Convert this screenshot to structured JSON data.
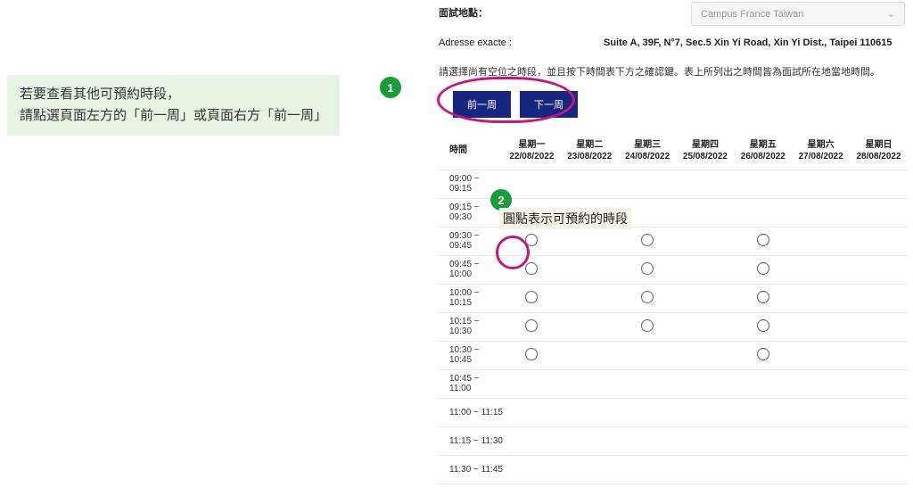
{
  "hint": {
    "line1": "若要查看其他可預約時段，",
    "line2": "請點選頁面左方的「前一周」或頁面右方「前一周」"
  },
  "location_label": "面試地點：",
  "location_value": "Campus France Taiwan",
  "address_label": "Adresse exacte :",
  "address_value": "Suite A, 39F, N°7, Sec.5 Xin Yi Road, Xin Yi Dist., Taipei 110615",
  "instruction": "請選擇尚有空位之時段，並且按下時間表下方之確認鍵。表上所列出之時間皆為面試所在地當地時間。",
  "buttons": {
    "prev": "前一周",
    "next": "下一周"
  },
  "badges": {
    "one": "1",
    "two": "2"
  },
  "radio_note": "圓點表示可預約的時段",
  "headers": {
    "time": "時間",
    "days": [
      {
        "dow": "星期一",
        "date": "22/08/2022"
      },
      {
        "dow": "星期二",
        "date": "23/08/2022"
      },
      {
        "dow": "星期三",
        "date": "24/08/2022"
      },
      {
        "dow": "星期四",
        "date": "25/08/2022"
      },
      {
        "dow": "星期五",
        "date": "26/08/2022"
      },
      {
        "dow": "星期六",
        "date": "27/08/2022"
      },
      {
        "dow": "星期日",
        "date": "28/08/2022"
      }
    ]
  },
  "slots": [
    {
      "time": "09:00 ~ 09:15",
      "avail": [
        false,
        false,
        false,
        false,
        false,
        false,
        false
      ]
    },
    {
      "time": "09:15 ~ 09:30",
      "avail": [
        false,
        false,
        false,
        false,
        false,
        false,
        false
      ]
    },
    {
      "time": "09:30 ~ 09:45",
      "avail": [
        true,
        false,
        true,
        false,
        true,
        false,
        false
      ]
    },
    {
      "time": "09:45 ~ 10:00",
      "avail": [
        true,
        false,
        true,
        false,
        true,
        false,
        false
      ]
    },
    {
      "time": "10:00 ~ 10:15",
      "avail": [
        true,
        false,
        true,
        false,
        true,
        false,
        false
      ]
    },
    {
      "time": "10:15 ~ 10:30",
      "avail": [
        true,
        false,
        true,
        false,
        true,
        false,
        false
      ]
    },
    {
      "time": "10:30 ~ 10:45",
      "avail": [
        true,
        false,
        false,
        false,
        true,
        false,
        false
      ]
    },
    {
      "time": "10:45 ~ 11:00",
      "avail": [
        false,
        false,
        false,
        false,
        false,
        false,
        false
      ]
    },
    {
      "time": "11:00 ~ 11:15",
      "avail": [
        false,
        false,
        false,
        false,
        false,
        false,
        false
      ]
    },
    {
      "time": "11:15 ~ 11:30",
      "avail": [
        false,
        false,
        false,
        false,
        false,
        false,
        false
      ]
    },
    {
      "time": "11:30 ~ 11:45",
      "avail": [
        false,
        false,
        false,
        false,
        false,
        false,
        false
      ]
    }
  ]
}
